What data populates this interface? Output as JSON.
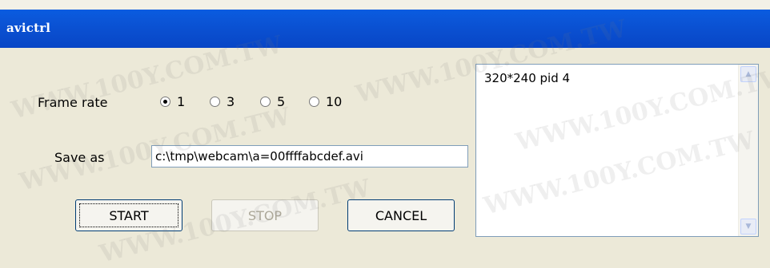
{
  "window": {
    "title": "avictrl"
  },
  "frame_rate": {
    "label": "Frame rate",
    "options": [
      "1",
      "3",
      "5",
      "10"
    ],
    "selected": "1"
  },
  "save_as": {
    "label": "Save as",
    "value": "c:\\tmp\\webcam\\a=00ffffabcdef.avi"
  },
  "buttons": {
    "start": "START",
    "stop": "STOP",
    "cancel": "CANCEL"
  },
  "log": {
    "text": "320*240 pid 4"
  },
  "watermark": "WWW.100Y.COM.TW"
}
